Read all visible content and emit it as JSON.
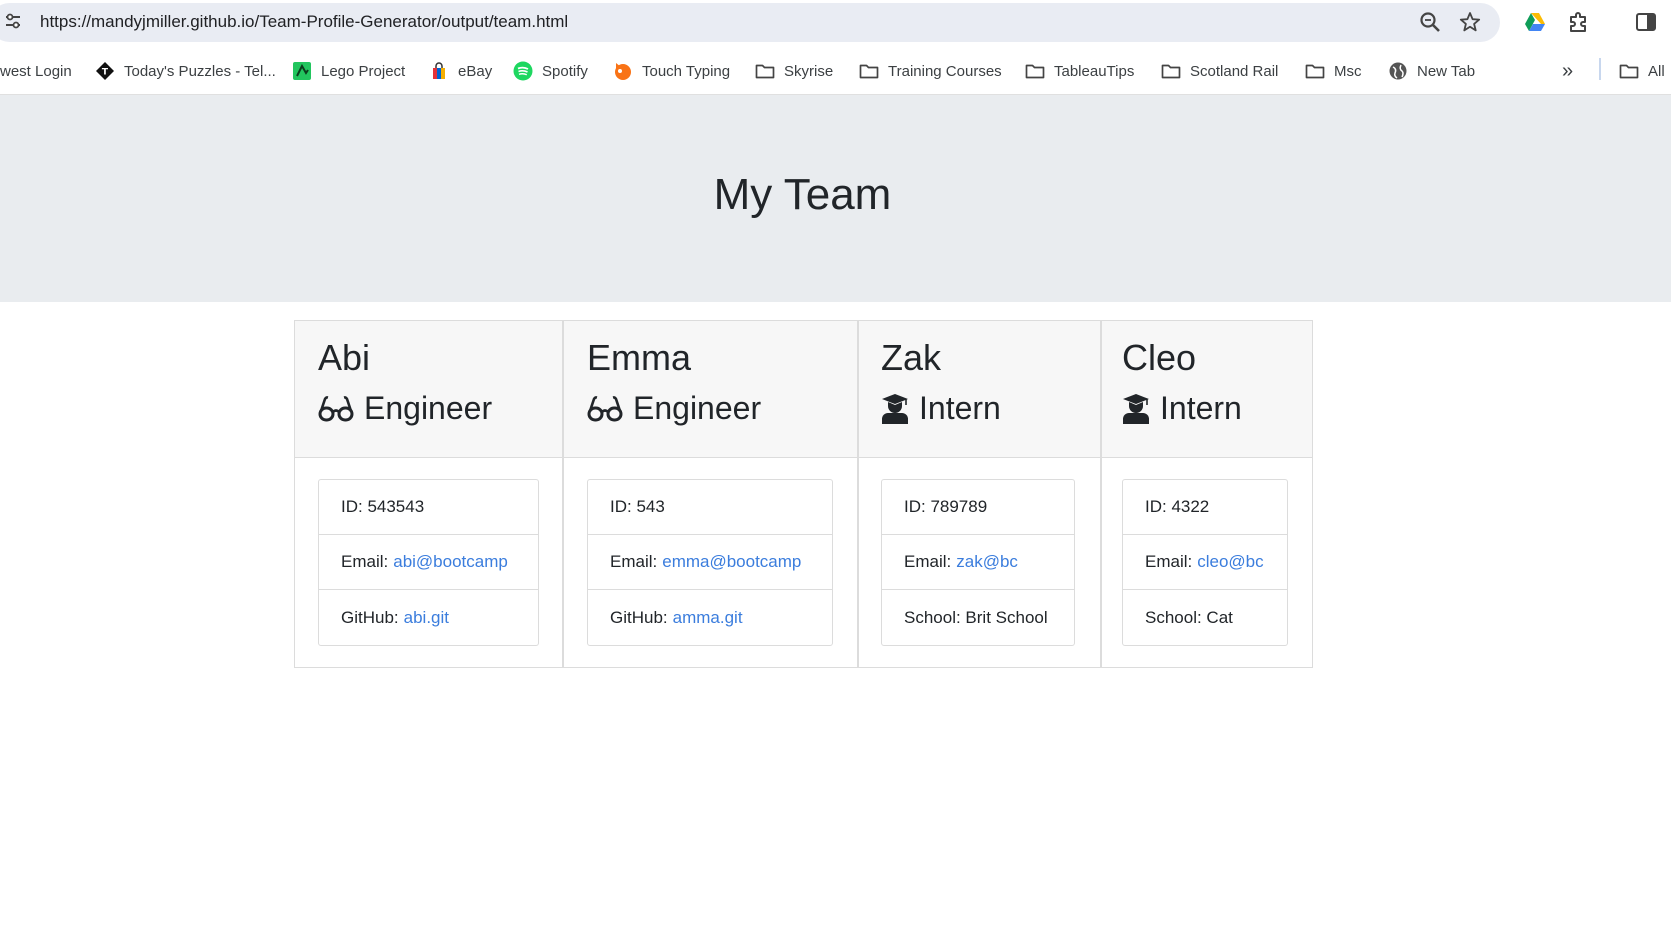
{
  "browser": {
    "url": "https://mandyjmiller.github.io/Team-Profile-Generator/output/team.html",
    "icons": [
      "site-info-icon",
      "zoom-icon",
      "star-icon",
      "google-drive-icon",
      "extensions-icon",
      "side-panel-icon"
    ]
  },
  "bookmarks": {
    "items": [
      {
        "label": "west Login",
        "icon": "none"
      },
      {
        "label": "Today's Puzzles - Tel...",
        "icon": "puzzle-diamond-icon"
      },
      {
        "label": "Lego Project",
        "icon": "green-page-icon"
      },
      {
        "label": "eBay",
        "icon": "shopping-bag-icon"
      },
      {
        "label": "Spotify",
        "icon": "spotify-icon"
      },
      {
        "label": "Touch Typing",
        "icon": "fox-icon"
      },
      {
        "label": "Skyrise",
        "icon": "folder-icon"
      },
      {
        "label": "Training Courses",
        "icon": "folder-icon"
      },
      {
        "label": "TableauTips",
        "icon": "folder-icon"
      },
      {
        "label": "Scotland Rail",
        "icon": "folder-icon"
      },
      {
        "label": "Msc",
        "icon": "folder-icon"
      },
      {
        "label": "New Tab",
        "icon": "globe-icon"
      }
    ],
    "overflow_label": "»",
    "all_label": "All"
  },
  "page": {
    "title": "My Team",
    "link_color": "#3b7ddd",
    "team": [
      {
        "name": "Abi",
        "role": "Engineer",
        "role_icon": "glasses-icon",
        "id": "ID: 543543",
        "email_label": "Email:",
        "email": "abi@bootcamp",
        "extra_label": "GitHub:",
        "extra_value": "abi.git",
        "extra_is_link": true
      },
      {
        "name": "Emma",
        "role": "Engineer",
        "role_icon": "glasses-icon",
        "id": "ID: 543",
        "email_label": "Email:",
        "email": "emma@bootcamp",
        "extra_label": "GitHub:",
        "extra_value": "amma.git",
        "extra_is_link": true
      },
      {
        "name": "Zak",
        "role": "Intern",
        "role_icon": "graduate-icon",
        "id": "ID: 789789",
        "email_label": "Email:",
        "email": "zak@bc",
        "extra_label": "School: Brit School",
        "extra_value": "",
        "extra_is_link": false
      },
      {
        "name": "Cleo",
        "role": "Intern",
        "role_icon": "graduate-icon",
        "id": "ID: 4322",
        "email_label": "Email:",
        "email": "cleo@bc",
        "extra_label": "School: Cat",
        "extra_value": "",
        "extra_is_link": false
      }
    ]
  }
}
